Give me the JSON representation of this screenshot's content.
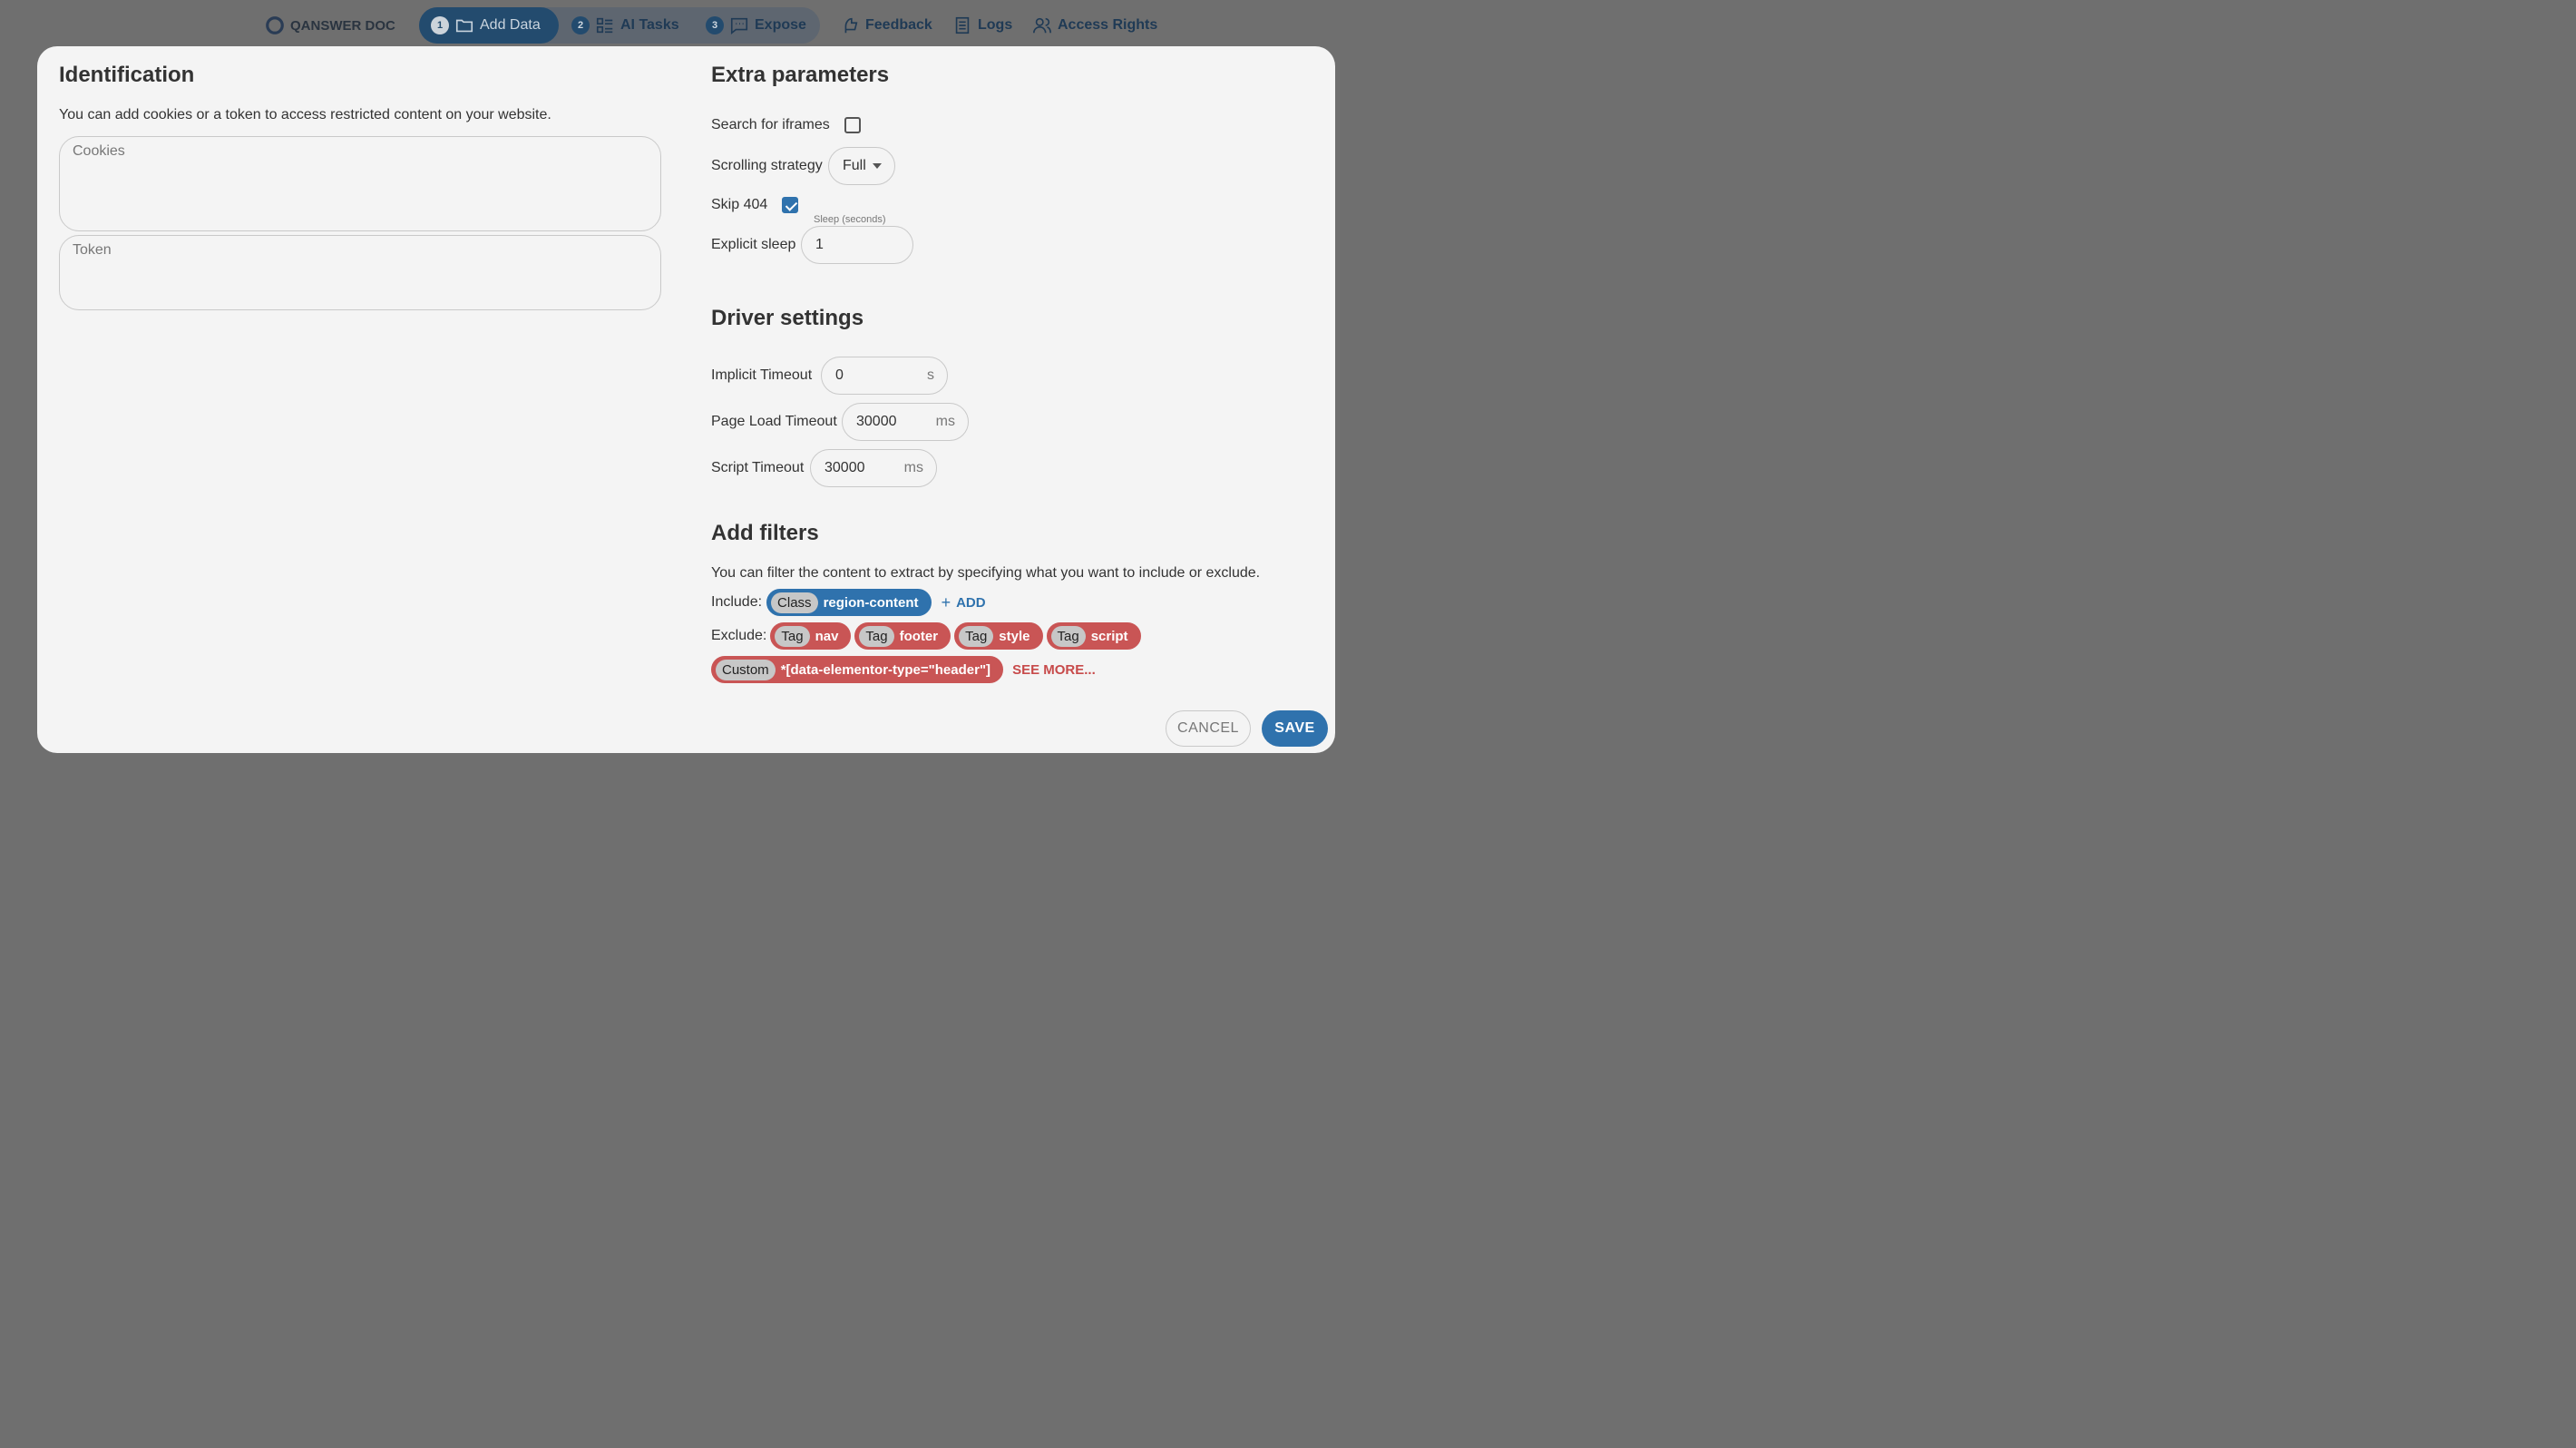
{
  "nav": {
    "logo_text": "QANSWER DOC",
    "steps": [
      {
        "num": "1",
        "label": "Add Data"
      },
      {
        "num": "2",
        "label": "AI Tasks"
      },
      {
        "num": "3",
        "label": "Expose"
      }
    ],
    "links": [
      {
        "label": "Feedback"
      },
      {
        "label": "Logs"
      },
      {
        "label": "Access Rights"
      }
    ]
  },
  "identification": {
    "title": "Identification",
    "description": "You can add cookies or a token to access restricted content on your website.",
    "cookies_placeholder": "Cookies",
    "token_placeholder": "Token"
  },
  "extra": {
    "title": "Extra parameters",
    "search_iframes_label": "Search for iframes",
    "search_iframes_checked": false,
    "scrolling_strategy_label": "Scrolling strategy",
    "scrolling_strategy_value": "Full",
    "skip404_label": "Skip 404",
    "skip404_checked": true,
    "explicit_sleep_label": "Explicit sleep",
    "sleep_field_label": "Sleep (seconds)",
    "sleep_value": "1"
  },
  "driver": {
    "title": "Driver settings",
    "implicit_label": "Implicit Timeout",
    "implicit_value": "0",
    "implicit_unit": "s",
    "pageload_label": "Page Load Timeout",
    "pageload_value": "30000",
    "pageload_unit": "ms",
    "script_label": "Script Timeout",
    "script_value": "30000",
    "script_unit": "ms"
  },
  "filters": {
    "title": "Add filters",
    "description": "You can filter the content to extract by specifying what you want to include or exclude.",
    "include_label": "Include:",
    "include": [
      {
        "kind": "Class",
        "value": "region-content"
      }
    ],
    "add_label": "ADD",
    "exclude_label": "Exclude:",
    "exclude": [
      {
        "kind": "Tag",
        "value": "nav"
      },
      {
        "kind": "Tag",
        "value": "footer"
      },
      {
        "kind": "Tag",
        "value": "style"
      },
      {
        "kind": "Tag",
        "value": "script"
      },
      {
        "kind": "Custom",
        "value": "*[data-elementor-type=\"header\"]"
      }
    ],
    "see_more_label": "SEE MORE..."
  },
  "actions": {
    "cancel_label": "CANCEL",
    "save_label": "SAVE"
  },
  "colors": {
    "primary": "#2f72ad",
    "danger": "#c95555",
    "nav_active": "#234b6e"
  }
}
